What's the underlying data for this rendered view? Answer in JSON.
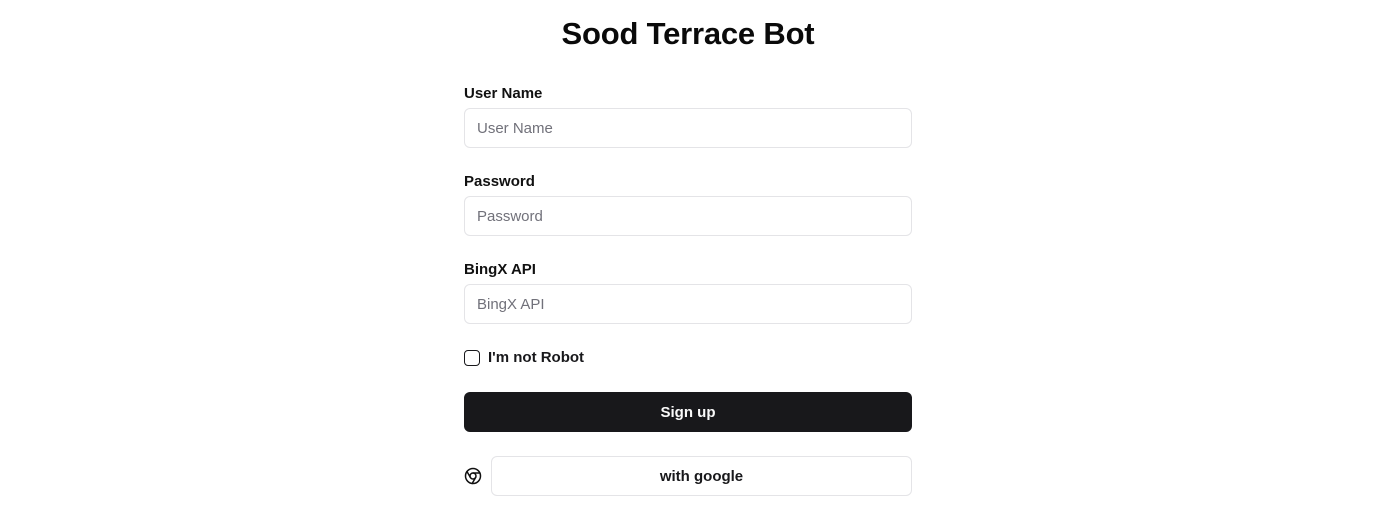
{
  "page": {
    "title": "Sood Terrace Bot"
  },
  "form": {
    "username": {
      "label": "User Name",
      "placeholder": "User Name",
      "value": ""
    },
    "password": {
      "label": "Password",
      "placeholder": "Password",
      "value": ""
    },
    "bingx_api": {
      "label": "BingX API",
      "placeholder": "BingX API",
      "value": ""
    },
    "robot_check": {
      "label": "I'm not Robot",
      "checked": false
    },
    "signup_label": "Sign up",
    "google": {
      "icon": "chrome-icon",
      "label": "with google"
    }
  },
  "colors": {
    "primary_button_bg": "#18181b",
    "primary_button_text": "#fafafa",
    "border": "#e4e4e7",
    "placeholder": "#71717a"
  }
}
